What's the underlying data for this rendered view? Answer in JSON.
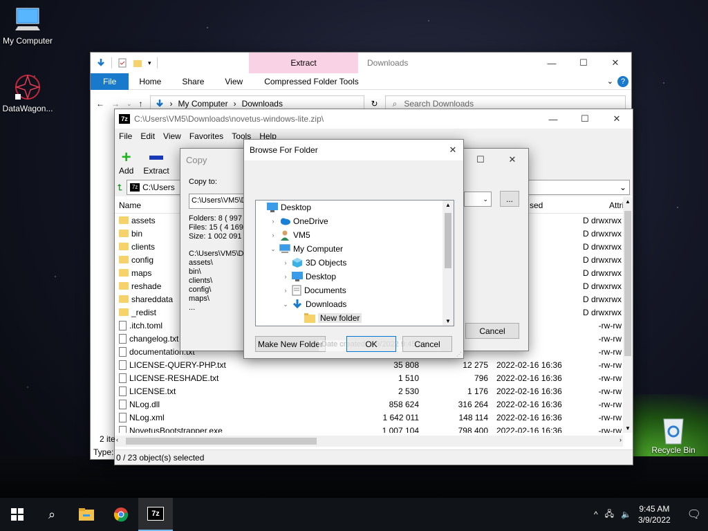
{
  "desktop": {
    "icons": [
      {
        "label": "My Computer"
      },
      {
        "label": "DataWagon..."
      },
      {
        "label": "Recycle Bin"
      }
    ]
  },
  "explorer": {
    "title": "Downloads",
    "context_tab": "Extract",
    "ribbon_tabs": [
      "File",
      "Home",
      "Share",
      "View",
      "Compressed Folder Tools"
    ],
    "breadcrumb": [
      "My Computer",
      "Downloads"
    ],
    "search_placeholder": "Search Downloads",
    "status": "Type:"
  },
  "zip": {
    "title": "C:\\Users\\VM5\\Downloads\\novetus-windows-lite.zip\\",
    "menu": [
      "File",
      "Edit",
      "View",
      "Favorites",
      "Tools",
      "Help"
    ],
    "tools": [
      "Add",
      "Extract"
    ],
    "path": "C:\\Users",
    "columns": {
      "name": "Name",
      "modified": "sed",
      "attributes": "Attrib"
    },
    "items": [
      {
        "name": "assets",
        "type": "folder",
        "attr": "D drwxrwx"
      },
      {
        "name": "bin",
        "type": "folder",
        "attr": "D drwxrwx"
      },
      {
        "name": "clients",
        "type": "folder",
        "attr": "D drwxrwx"
      },
      {
        "name": "config",
        "type": "folder",
        "attr": "D drwxrwx"
      },
      {
        "name": "maps",
        "type": "folder",
        "attr": "D drwxrwx"
      },
      {
        "name": "reshade",
        "type": "folder",
        "attr": "D drwxrwx"
      },
      {
        "name": "shareddata",
        "type": "folder",
        "attr": "D drwxrwx"
      },
      {
        "name": "_redist",
        "type": "folder",
        "attr": "D drwxrwx"
      },
      {
        "name": ".itch.toml",
        "type": "file",
        "attr": "-rw-rw"
      },
      {
        "name": "changelog.txt",
        "type": "file",
        "attr": "-rw-rw"
      },
      {
        "name": "documentation.txt",
        "type": "file",
        "attr": "-rw-rw"
      },
      {
        "name": "LICENSE-QUERY-PHP.txt",
        "type": "file",
        "size": "35 808",
        "packed": "12 275",
        "modified": "2022-02-16 16:36",
        "attr": "-rw-rw"
      },
      {
        "name": "LICENSE-RESHADE.txt",
        "type": "file",
        "size": "1 510",
        "packed": "796",
        "modified": "2022-02-16 16:36",
        "attr": "-rw-rw"
      },
      {
        "name": "LICENSE.txt",
        "type": "file",
        "size": "2 530",
        "packed": "1 176",
        "modified": "2022-02-16 16:36",
        "attr": "-rw-rw"
      },
      {
        "name": "NLog.dll",
        "type": "file",
        "size": "858 624",
        "packed": "316 264",
        "modified": "2022-02-16 16:36",
        "attr": "-rw-rw"
      },
      {
        "name": "NLog.xml",
        "type": "file",
        "size": "1 642 011",
        "packed": "148 114",
        "modified": "2022-02-16 16:36",
        "attr": "-rw-rw"
      },
      {
        "name": "NovetusBootstrapper.exe",
        "type": "file",
        "size": "1 007 104",
        "packed": "798 400",
        "modified": "2022-02-16 16:36",
        "attr": "-rw-rw"
      }
    ],
    "left_count": "2 ite",
    "status": "0 / 23 object(s) selected"
  },
  "copy": {
    "title": "Copy",
    "copy_to_label": "Copy to:",
    "path": "C:\\Users\\VM5\\D",
    "stats": [
      "Folders: 8   ( 997",
      "Files: 15   ( 4 169",
      "Size:  1 002 091 7"
    ],
    "listing": [
      "C:\\Users\\VM5\\D",
      "  assets\\",
      "  bin\\",
      "  clients\\",
      "  config\\",
      "  maps\\",
      "  ..."
    ],
    "browse_btn": "...",
    "cancel_btn": "Cancel"
  },
  "browse": {
    "title": "Browse For Folder",
    "tree": [
      {
        "label": "Desktop",
        "level": 0,
        "expander": "",
        "icon": "desktop"
      },
      {
        "label": "OneDrive",
        "level": 1,
        "expander": ">",
        "icon": "cloud"
      },
      {
        "label": "VM5",
        "level": 1,
        "expander": ">",
        "icon": "user"
      },
      {
        "label": "My Computer",
        "level": 1,
        "expander": "v",
        "icon": "computer"
      },
      {
        "label": "3D Objects",
        "level": 2,
        "expander": ">",
        "icon": "cube"
      },
      {
        "label": "Desktop",
        "level": 2,
        "expander": ">",
        "icon": "desktop"
      },
      {
        "label": "Documents",
        "level": 2,
        "expander": ">",
        "icon": "document"
      },
      {
        "label": "Downloads",
        "level": 2,
        "expander": "v",
        "icon": "download"
      },
      {
        "label": "New folder",
        "level": 3,
        "expander": "",
        "icon": "folder",
        "selected": true
      }
    ],
    "make_new_folder": "Make New Folder",
    "ok": "OK",
    "cancel": "Cancel",
    "tooltip": "Date created: 3/9/2022 9:45 AM"
  },
  "taskbar": {
    "time": "9:45 AM",
    "date": "3/9/2022",
    "apps": [
      "file-explorer",
      "chrome",
      "7-zip"
    ],
    "active_app_label": "7z"
  },
  "colors": {
    "accent": "#1979ca",
    "extract_tab": "#f9d2e6",
    "taskbar": "#101317"
  }
}
